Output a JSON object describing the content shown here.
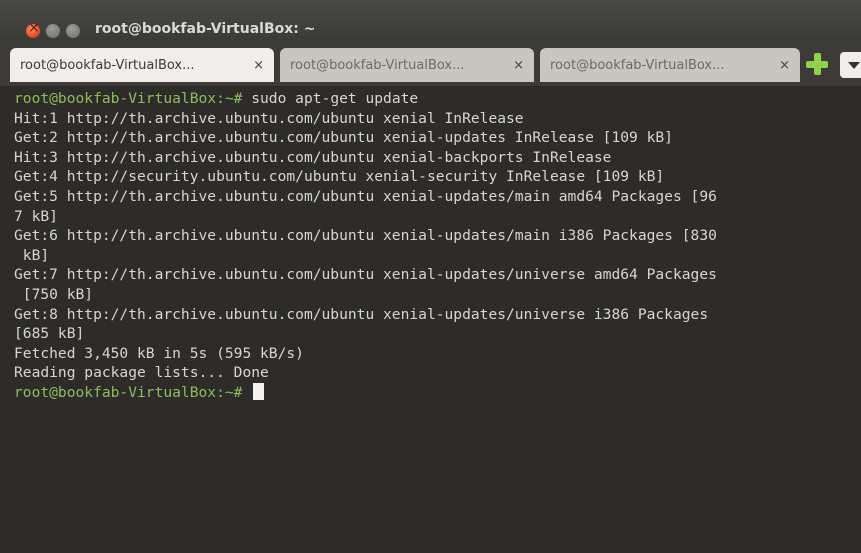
{
  "window": {
    "title": "root@bookfab-VirtualBox: ~"
  },
  "tabs": [
    {
      "label": "root@bookfab-VirtualBox...",
      "close": "×",
      "active": true
    },
    {
      "label": "root@bookfab-VirtualBox...",
      "close": "×",
      "active": false
    },
    {
      "label": "root@bookfab-VirtualBox...",
      "close": "×",
      "active": false
    }
  ],
  "terminal": {
    "prompt": "root@bookfab-VirtualBox:~#",
    "command": " sudo apt-get update",
    "output": [
      "Hit:1 http://th.archive.ubuntu.com/ubuntu xenial InRelease",
      "Get:2 http://th.archive.ubuntu.com/ubuntu xenial-updates InRelease [109 kB]",
      "Hit:3 http://th.archive.ubuntu.com/ubuntu xenial-backports InRelease",
      "Get:4 http://security.ubuntu.com/ubuntu xenial-security InRelease [109 kB]",
      "Get:5 http://th.archive.ubuntu.com/ubuntu xenial-updates/main amd64 Packages [96",
      "7 kB]",
      "Get:6 http://th.archive.ubuntu.com/ubuntu xenial-updates/main i386 Packages [830",
      " kB]",
      "Get:7 http://th.archive.ubuntu.com/ubuntu xenial-updates/universe amd64 Packages",
      " [750 kB]",
      "Get:8 http://th.archive.ubuntu.com/ubuntu xenial-updates/universe i386 Packages",
      "[685 kB]",
      "Fetched 3,450 kB in 5s (595 kB/s)",
      "Reading package lists... Done"
    ],
    "final_prompt": "root@bookfab-VirtualBox:~#"
  },
  "colors": {
    "prompt": "#8dbd5b",
    "terminal_bg": "#2d2c2a",
    "text": "#d8d6d0",
    "add_tab": "#8ed34a",
    "close_button": "#e1502c"
  }
}
